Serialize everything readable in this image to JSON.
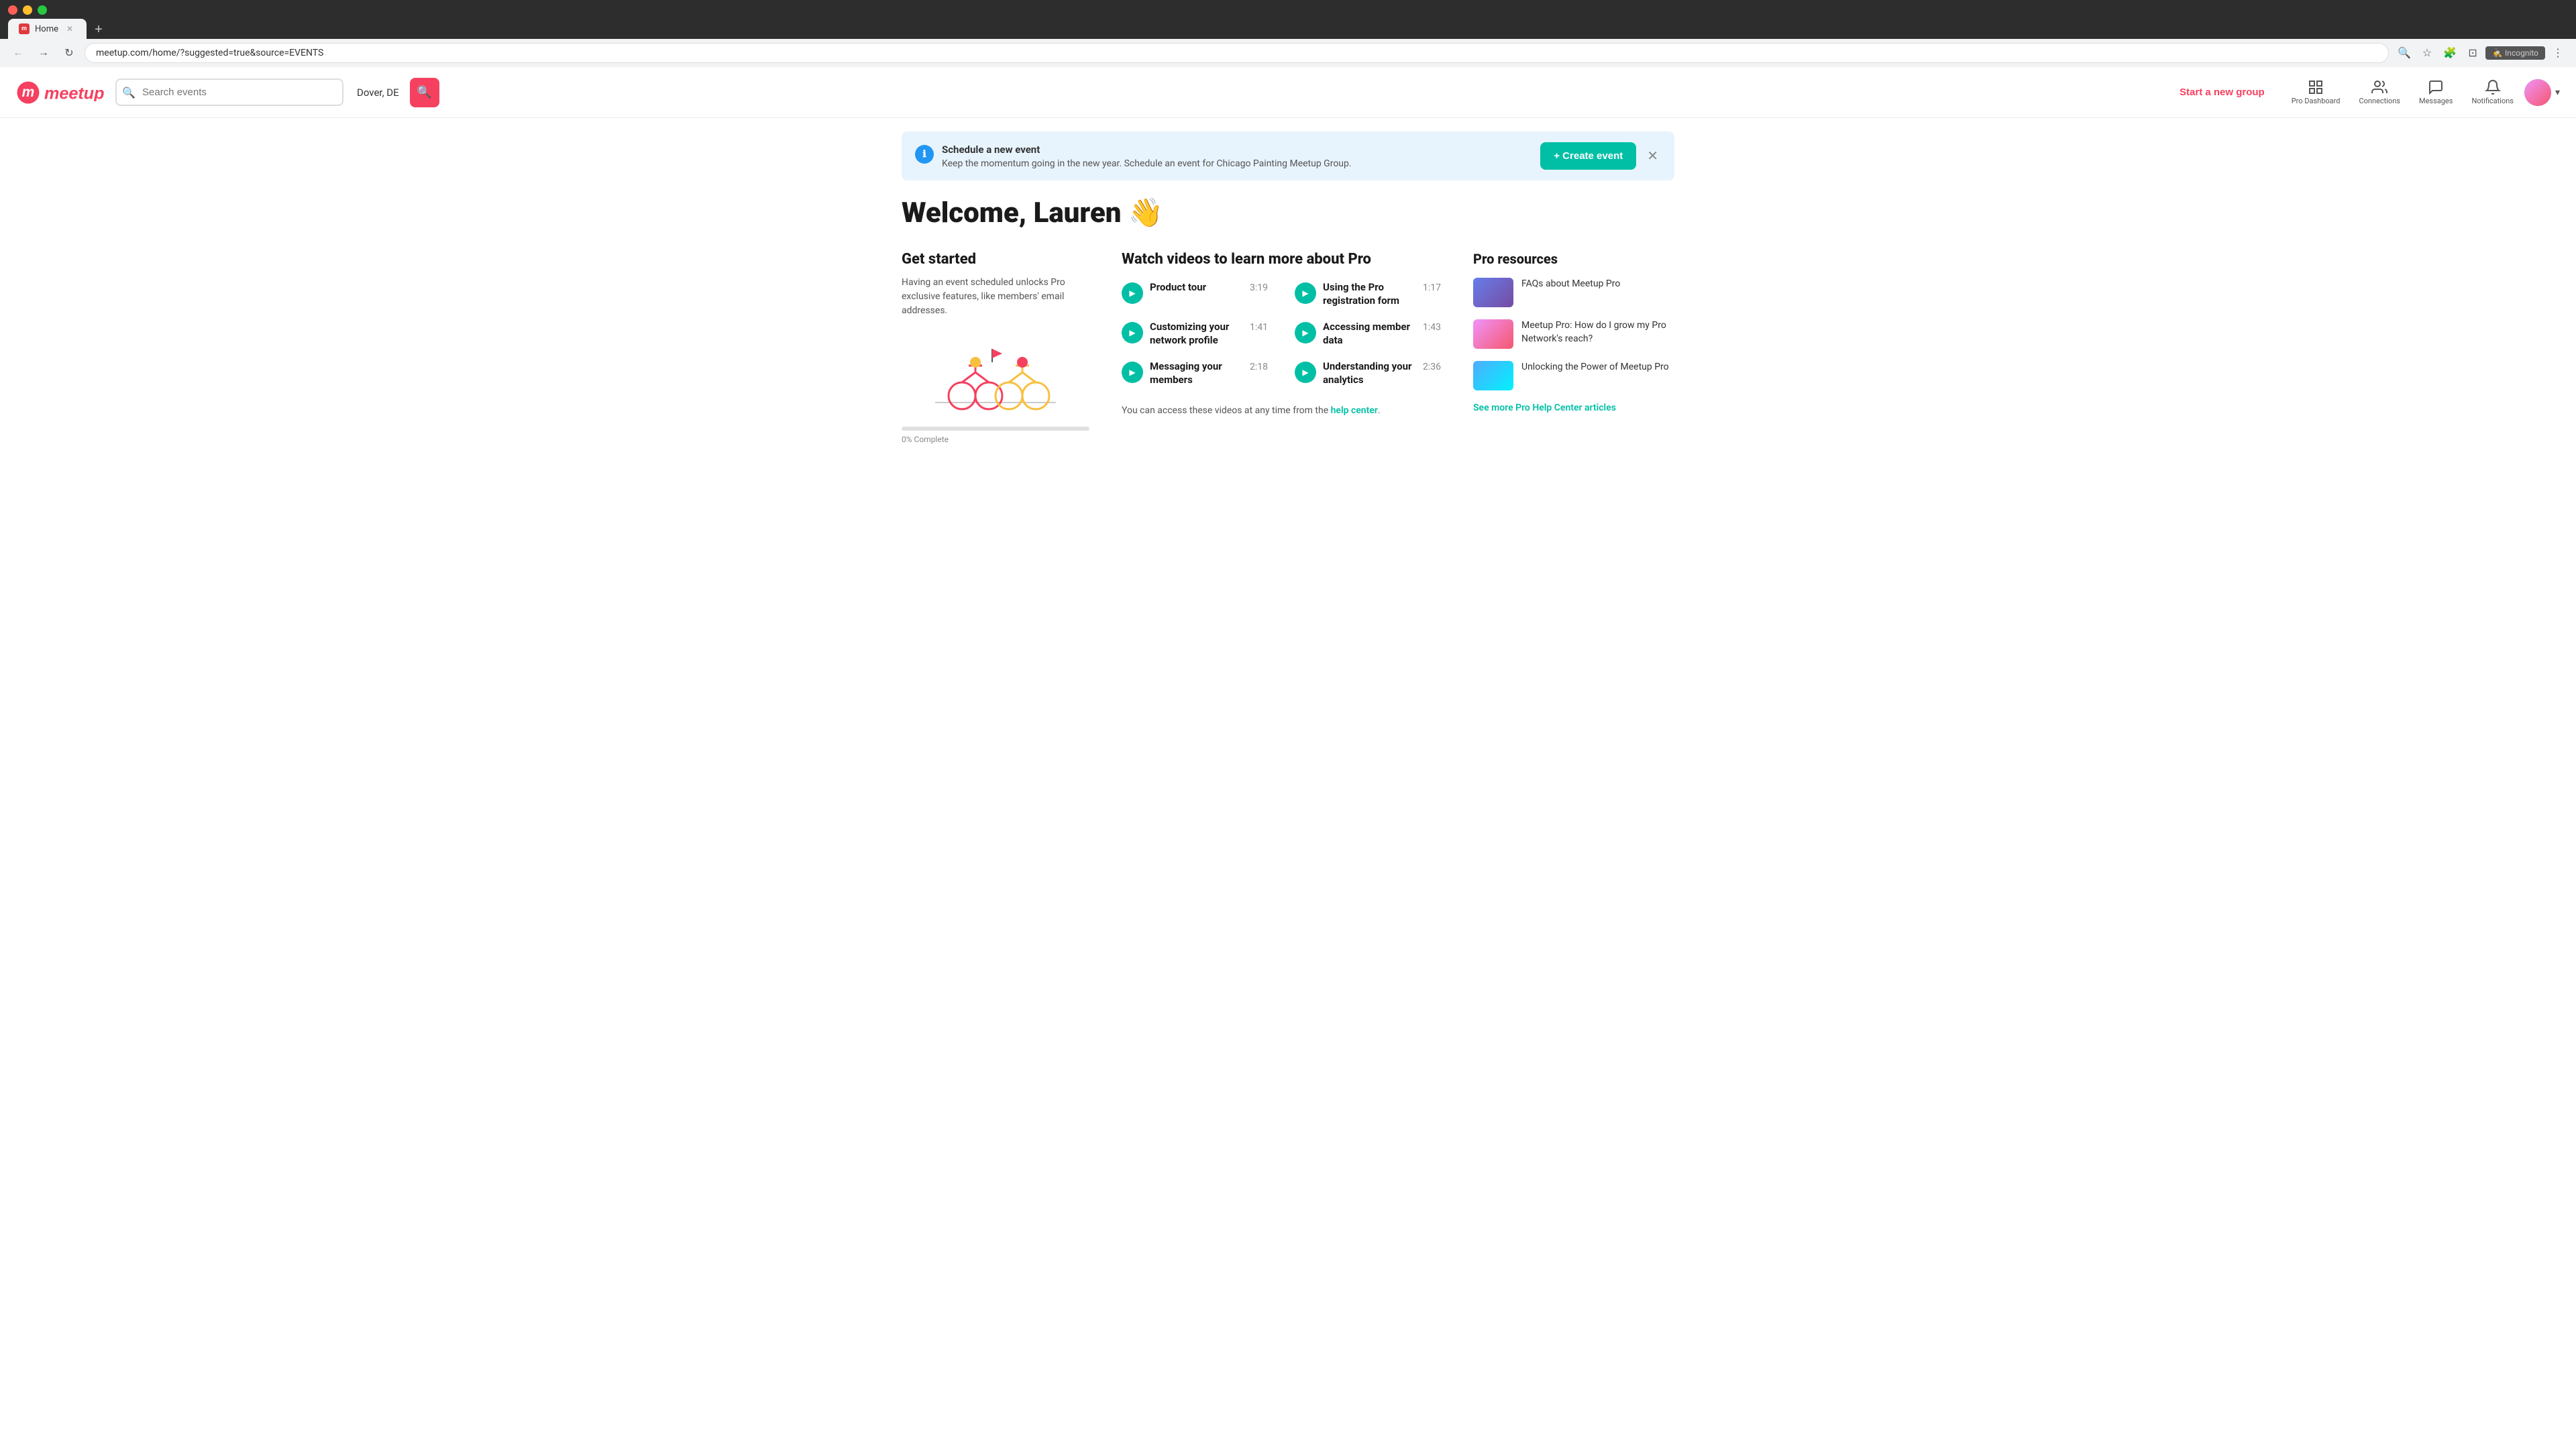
{
  "browser": {
    "tab_title": "Home",
    "url": "meetup.com/home/?suggested=true&source=EVENTS",
    "incognito_label": "Incognito"
  },
  "nav": {
    "logo_text": "meetup",
    "search_placeholder": "Search events",
    "location": "Dover, DE",
    "start_new_group_label": "Start a new group",
    "pro_dashboard_label": "Pro Dashboard",
    "connections_label": "Connections",
    "messages_label": "Messages",
    "notifications_label": "Notifications"
  },
  "banner": {
    "title": "Schedule a new event",
    "description": "Keep the momentum going in the new year. Schedule an event for Chicago Painting Meetup Group.",
    "create_event_label": "+ Create event"
  },
  "welcome": {
    "heading": "Welcome, Lauren"
  },
  "get_started": {
    "title": "Get started",
    "description": "Having an event scheduled unlocks Pro exclusive features, like members' email addresses.",
    "progress_label": "0% Complete"
  },
  "videos": {
    "section_title": "Watch videos to learn more about Pro",
    "items": [
      {
        "title": "Product tour",
        "duration": "3:19"
      },
      {
        "title": "Using the Pro registration form",
        "duration": "1:17"
      },
      {
        "title": "Customizing your network profile",
        "duration": "1:41"
      },
      {
        "title": "Accessing member data",
        "duration": "1:43"
      },
      {
        "title": "Messaging your members",
        "duration": "2:18"
      },
      {
        "title": "Understanding your analytics",
        "duration": "2:36"
      }
    ],
    "help_text_prefix": "You can access these videos at any time from the ",
    "help_link_text": "help center",
    "help_text_suffix": "."
  },
  "pro_resources": {
    "title": "Pro resources",
    "items": [
      {
        "title": "FAQs about Meetup Pro"
      },
      {
        "title": "Meetup Pro: How do I grow my Pro Network's reach?"
      },
      {
        "title": "Unlocking the Power of Meetup Pro"
      }
    ],
    "see_more_label": "See more Pro Help Center articles"
  }
}
